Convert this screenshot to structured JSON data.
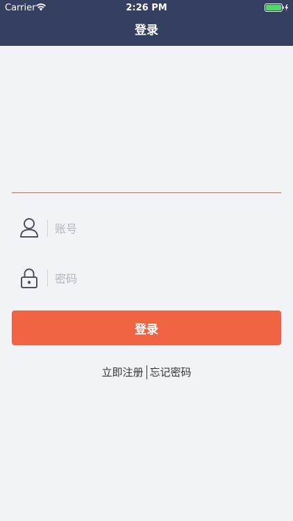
{
  "status_bar": {
    "carrier": "Carrier",
    "time": "2:26 PM"
  },
  "nav": {
    "title": "登录"
  },
  "form": {
    "account_placeholder": "账号",
    "password_placeholder": "密码",
    "login_label": "登录"
  },
  "links": {
    "register": "立即注册",
    "forgot_password": "忘记密码"
  },
  "icons": {
    "account": "user-icon",
    "password": "lock-icon"
  },
  "colors": {
    "header_bg": "#343f61",
    "accent": "#f06443",
    "page_bg": "#f1f3f6"
  }
}
